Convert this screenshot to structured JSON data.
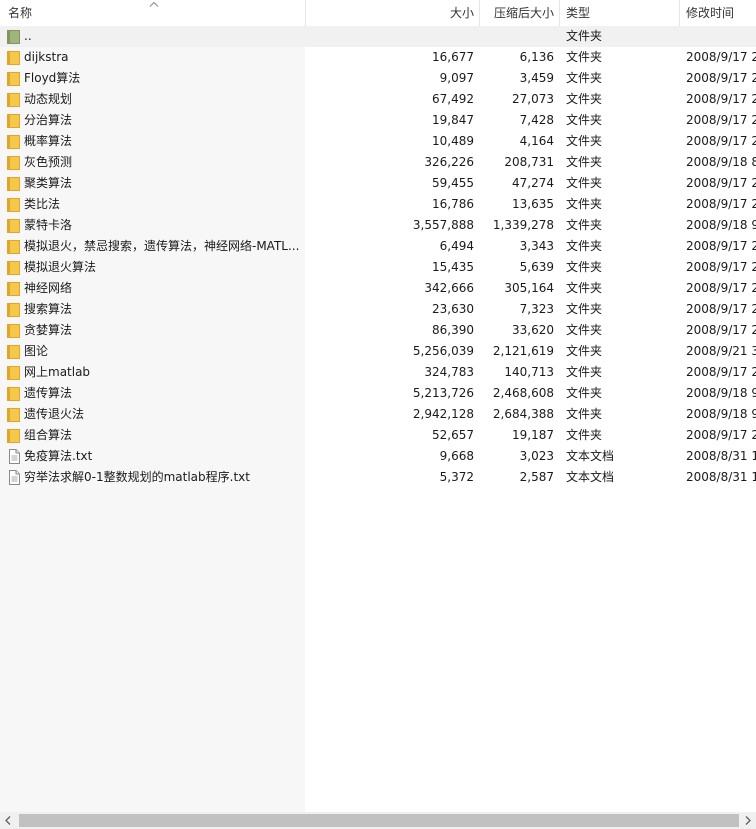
{
  "columns": {
    "name": "名称",
    "size": "大小",
    "packed": "压缩后大小",
    "type": "类型",
    "modified": "修改时间"
  },
  "sort": {
    "column": "name",
    "direction": "ascending",
    "icon": "sort-up-arrow-icon"
  },
  "rows": [
    {
      "icon": "parent-folder-icon",
      "name": "..",
      "size": "",
      "packed": "",
      "type": "文件夹",
      "modified": ""
    },
    {
      "icon": "folder-icon",
      "name": "dijkstra",
      "size": "16,677",
      "packed": "6,136",
      "type": "文件夹",
      "modified": "2008/9/17 2"
    },
    {
      "icon": "folder-icon",
      "name": "Floyd算法",
      "size": "9,097",
      "packed": "3,459",
      "type": "文件夹",
      "modified": "2008/9/17 2"
    },
    {
      "icon": "folder-icon",
      "name": "动态规划",
      "size": "67,492",
      "packed": "27,073",
      "type": "文件夹",
      "modified": "2008/9/17 2"
    },
    {
      "icon": "folder-icon",
      "name": "分治算法",
      "size": "19,847",
      "packed": "7,428",
      "type": "文件夹",
      "modified": "2008/9/17 2"
    },
    {
      "icon": "folder-icon",
      "name": "概率算法",
      "size": "10,489",
      "packed": "4,164",
      "type": "文件夹",
      "modified": "2008/9/17 2"
    },
    {
      "icon": "folder-icon",
      "name": "灰色预测",
      "size": "326,226",
      "packed": "208,731",
      "type": "文件夹",
      "modified": "2008/9/18 8"
    },
    {
      "icon": "folder-icon",
      "name": "聚类算法",
      "size": "59,455",
      "packed": "47,274",
      "type": "文件夹",
      "modified": "2008/9/17 2"
    },
    {
      "icon": "folder-icon",
      "name": "类比法",
      "size": "16,786",
      "packed": "13,635",
      "type": "文件夹",
      "modified": "2008/9/17 2"
    },
    {
      "icon": "folder-icon",
      "name": "蒙特卡洛",
      "size": "3,557,888",
      "packed": "1,339,278",
      "type": "文件夹",
      "modified": "2008/9/18 9"
    },
    {
      "icon": "folder-icon",
      "name": "模拟退火，禁忌搜索，遗传算法，神经网络-MATL...",
      "size": "6,494",
      "packed": "3,343",
      "type": "文件夹",
      "modified": "2008/9/17 2"
    },
    {
      "icon": "folder-icon",
      "name": "模拟退火算法",
      "size": "15,435",
      "packed": "5,639",
      "type": "文件夹",
      "modified": "2008/9/17 2"
    },
    {
      "icon": "folder-icon",
      "name": "神经网络",
      "size": "342,666",
      "packed": "305,164",
      "type": "文件夹",
      "modified": "2008/9/17 2"
    },
    {
      "icon": "folder-icon",
      "name": "搜索算法",
      "size": "23,630",
      "packed": "7,323",
      "type": "文件夹",
      "modified": "2008/9/17 2"
    },
    {
      "icon": "folder-icon",
      "name": "贪婪算法",
      "size": "86,390",
      "packed": "33,620",
      "type": "文件夹",
      "modified": "2008/9/17 2"
    },
    {
      "icon": "folder-icon",
      "name": "图论",
      "size": "5,256,039",
      "packed": "2,121,619",
      "type": "文件夹",
      "modified": "2008/9/21 3"
    },
    {
      "icon": "folder-icon",
      "name": "网上matlab",
      "size": "324,783",
      "packed": "140,713",
      "type": "文件夹",
      "modified": "2008/9/17 2"
    },
    {
      "icon": "folder-icon",
      "name": "遗传算法",
      "size": "5,213,726",
      "packed": "2,468,608",
      "type": "文件夹",
      "modified": "2008/9/18 9"
    },
    {
      "icon": "folder-icon",
      "name": "遗传退火法",
      "size": "2,942,128",
      "packed": "2,684,388",
      "type": "文件夹",
      "modified": "2008/9/18 9"
    },
    {
      "icon": "folder-icon",
      "name": "组合算法",
      "size": "52,657",
      "packed": "19,187",
      "type": "文件夹",
      "modified": "2008/9/17 2"
    },
    {
      "icon": "text-file-icon",
      "name": "免疫算法.txt",
      "size": "9,668",
      "packed": "3,023",
      "type": "文本文档",
      "modified": "2008/8/31 1"
    },
    {
      "icon": "text-file-icon",
      "name": "穷举法求解0-1整数规划的matlab程序.txt",
      "size": "5,372",
      "packed": "2,587",
      "type": "文本文档",
      "modified": "2008/8/31 1"
    }
  ],
  "scrollbar": {
    "left_icon": "scroll-left-arrow-icon",
    "right_icon": "scroll-right-arrow-icon",
    "position": 0
  },
  "colors": {
    "folder": "#f5c84c",
    "folder_dark": "#e1a629",
    "parent_folder": "#9fb57a",
    "name_column_bg": "#f7f7f7",
    "scrollbar_thumb": "#c1c1c1"
  }
}
